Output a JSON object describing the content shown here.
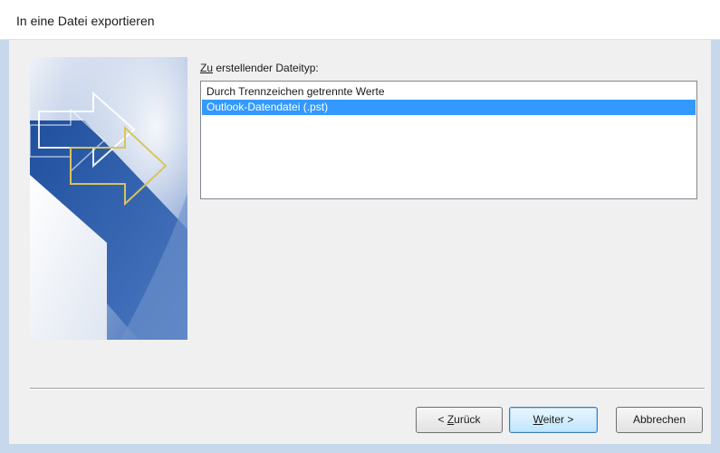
{
  "window": {
    "title": "In eine Datei exportieren"
  },
  "file_type": {
    "label_mnemonic": "Zu",
    "label_rest": " erstellender Dateityp:",
    "items": [
      {
        "label": "Durch Trennzeichen getrennte Werte",
        "selected": false
      },
      {
        "label": "Outlook-Datendatei (.pst)",
        "selected": true
      }
    ]
  },
  "buttons": {
    "back_prefix": "< ",
    "back_mnemonic": "Z",
    "back_rest": "urück",
    "next_mnemonic": "W",
    "next_rest": "eiter >",
    "cancel": "Abbrechen"
  },
  "colors": {
    "selection": "#3399ff",
    "image_blue": "#2f5fa8",
    "arrow_gold": "#d9c45a"
  },
  "icons": {
    "wizard_image": "export-arrow-graphic"
  }
}
